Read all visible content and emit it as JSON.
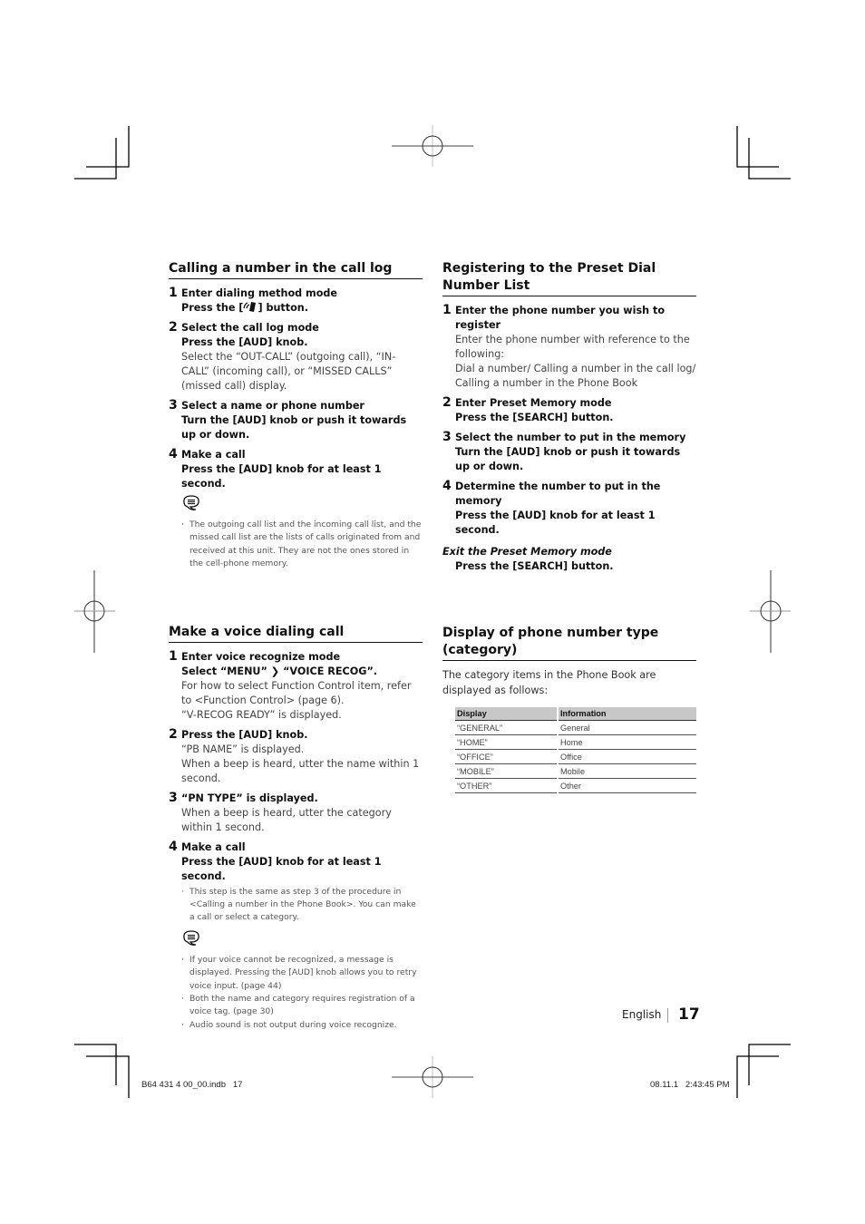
{
  "left_column": {
    "section1": {
      "title": "Calling a number in the call log",
      "steps": [
        {
          "num": "1",
          "title": "Enter dialing method mode",
          "action_pre": "Press the [",
          "action_post": "] button.",
          "action_icon": "phone-handset-icon"
        },
        {
          "num": "2",
          "title": "Select the call log mode",
          "action": "Press the [AUD] knob.",
          "desc": "Select the “OUT-CALL” (outgoing call), “IN-CALL” (incoming call), or “MISSED CALLS” (missed call) display."
        },
        {
          "num": "3",
          "title": "Select a name or phone number",
          "action": "Turn the [AUD] knob or push it towards up or down."
        },
        {
          "num": "4",
          "title": "Make a call",
          "action": "Press the [AUD] knob for at least 1 second."
        }
      ],
      "memo_icon": "memo-note-icon",
      "notes": [
        "The outgoing call list and the incoming call list, and the missed call list are the lists of calls originated from and received at this unit. They are not the ones stored in the cell-phone memory."
      ]
    },
    "section2": {
      "title": "Make a voice dialing call",
      "steps": [
        {
          "num": "1",
          "title": "Enter voice recognize mode",
          "action_a": "Select “MENU”",
          "action_arrow": "❯",
          "action_b": "“VOICE RECOG”.",
          "desc_lines": [
            "For how to select Function Control item, refer to <Function Control> (page 6).",
            "“V-RECOG READY” is displayed."
          ]
        },
        {
          "num": "2",
          "title": "Press the [AUD] knob.",
          "desc_lines": [
            "“PB NAME” is displayed.",
            "When a beep is heard, utter the name within 1 second."
          ]
        },
        {
          "num": "3",
          "title": "“PN TYPE” is displayed.",
          "desc_lines": [
            "When a beep is heard, utter the category within 1 second."
          ]
        },
        {
          "num": "4",
          "title": "Make a call",
          "action": "Press the [AUD] knob for at least 1 second.",
          "notes": [
            "This step is the same as step 3 of the procedure in <Calling a number in the Phone Book>. You can make a call or select a category."
          ]
        }
      ],
      "memo_icon": "memo-note-icon",
      "notes": [
        "If your voice cannot be recognized, a message is displayed. Pressing the [AUD] knob allows you to retry voice input. (page 44)",
        "Both the name and category requires registration of a voice tag. (page 30)",
        "Audio sound is not output during voice recognize."
      ]
    }
  },
  "right_column": {
    "section1": {
      "title": "Registering to the Preset Dial Number List",
      "steps": [
        {
          "num": "1",
          "title": "Enter the phone number you wish to register",
          "desc_lines": [
            "Enter the phone number with reference to the following:",
            "Dial a number/ Calling a number in the call log/ Calling a number in the Phone Book"
          ]
        },
        {
          "num": "2",
          "title": "Enter Preset Memory mode",
          "action": "Press the [SEARCH] button."
        },
        {
          "num": "3",
          "title": "Select the number to put in the memory",
          "action": "Turn the [AUD] knob or push it towards up or down."
        },
        {
          "num": "4",
          "title": "Determine the number to put in the memory",
          "action": "Press the [AUD] knob for at least 1 second."
        }
      ],
      "exit_title": "Exit the Preset Memory mode",
      "exit_action": "Press the [SEARCH] button."
    },
    "section2": {
      "title": "Display of phone number type (category)",
      "intro": "The category items in the Phone Book are displayed as follows:",
      "table": {
        "headers": [
          "Display",
          "Information"
        ],
        "rows": [
          [
            "“GENERAL”",
            "General"
          ],
          [
            "“HOME”",
            "Home"
          ],
          [
            "“OFFICE”",
            "Office"
          ],
          [
            "“MOBILE”",
            "Mobile"
          ],
          [
            "“OTHER”",
            "Other"
          ]
        ]
      }
    }
  },
  "footer": {
    "language": "English",
    "page_number": "17",
    "slug_file": "B64 431 4 00_00.indb   17",
    "slug_date": "08.11.1   2:43:45 PM"
  }
}
